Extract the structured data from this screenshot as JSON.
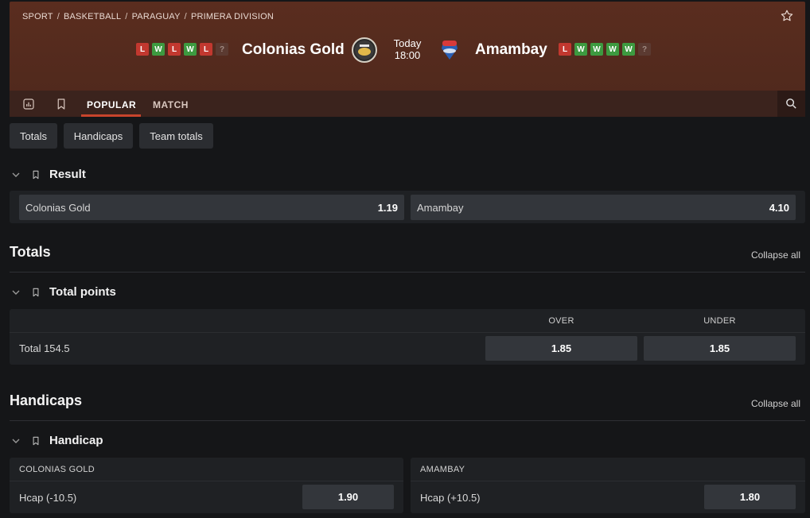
{
  "breadcrumb": [
    "SPORT",
    "BASKETBALL",
    "PARAGUAY",
    "PRIMERA DIVISION"
  ],
  "match": {
    "home": {
      "name": "Colonias Gold",
      "form": [
        "L",
        "W",
        "L",
        "W",
        "L",
        "?"
      ]
    },
    "away": {
      "name": "Amambay",
      "form": [
        "L",
        "W",
        "W",
        "W",
        "W",
        "?"
      ]
    },
    "day": "Today",
    "time": "18:00"
  },
  "tabs": {
    "popular": "POPULAR",
    "match": "MATCH"
  },
  "filters": [
    "Totals",
    "Handicaps",
    "Team totals"
  ],
  "result": {
    "title": "Result",
    "home": {
      "label": "Colonias Gold",
      "odd": "1.19"
    },
    "away": {
      "label": "Amambay",
      "odd": "4.10"
    }
  },
  "totals": {
    "section_title": "Totals",
    "collapse": "Collapse all",
    "market_title": "Total points",
    "over_header": "OVER",
    "under_header": "UNDER",
    "line_label": "Total 154.5",
    "over_odd": "1.85",
    "under_odd": "1.85"
  },
  "handicaps": {
    "section_title": "Handicaps",
    "collapse": "Collapse all",
    "market_title": "Handicap",
    "home_header": "COLONIAS GOLD",
    "away_header": "AMAMBAY",
    "home_line": "Hcap (-10.5)",
    "home_odd": "1.90",
    "away_line": "Hcap (+10.5)",
    "away_odd": "1.80"
  },
  "colors": {
    "loss": "#c2382f",
    "win": "#3d9a40",
    "accent": "#c9442c",
    "header_bg": "#5a2d1f"
  },
  "icons": {
    "favorite": "star-icon",
    "stats": "stats-icon",
    "bookmark": "bookmark-icon",
    "search": "search-icon",
    "collapse": "chevron-down-icon"
  }
}
